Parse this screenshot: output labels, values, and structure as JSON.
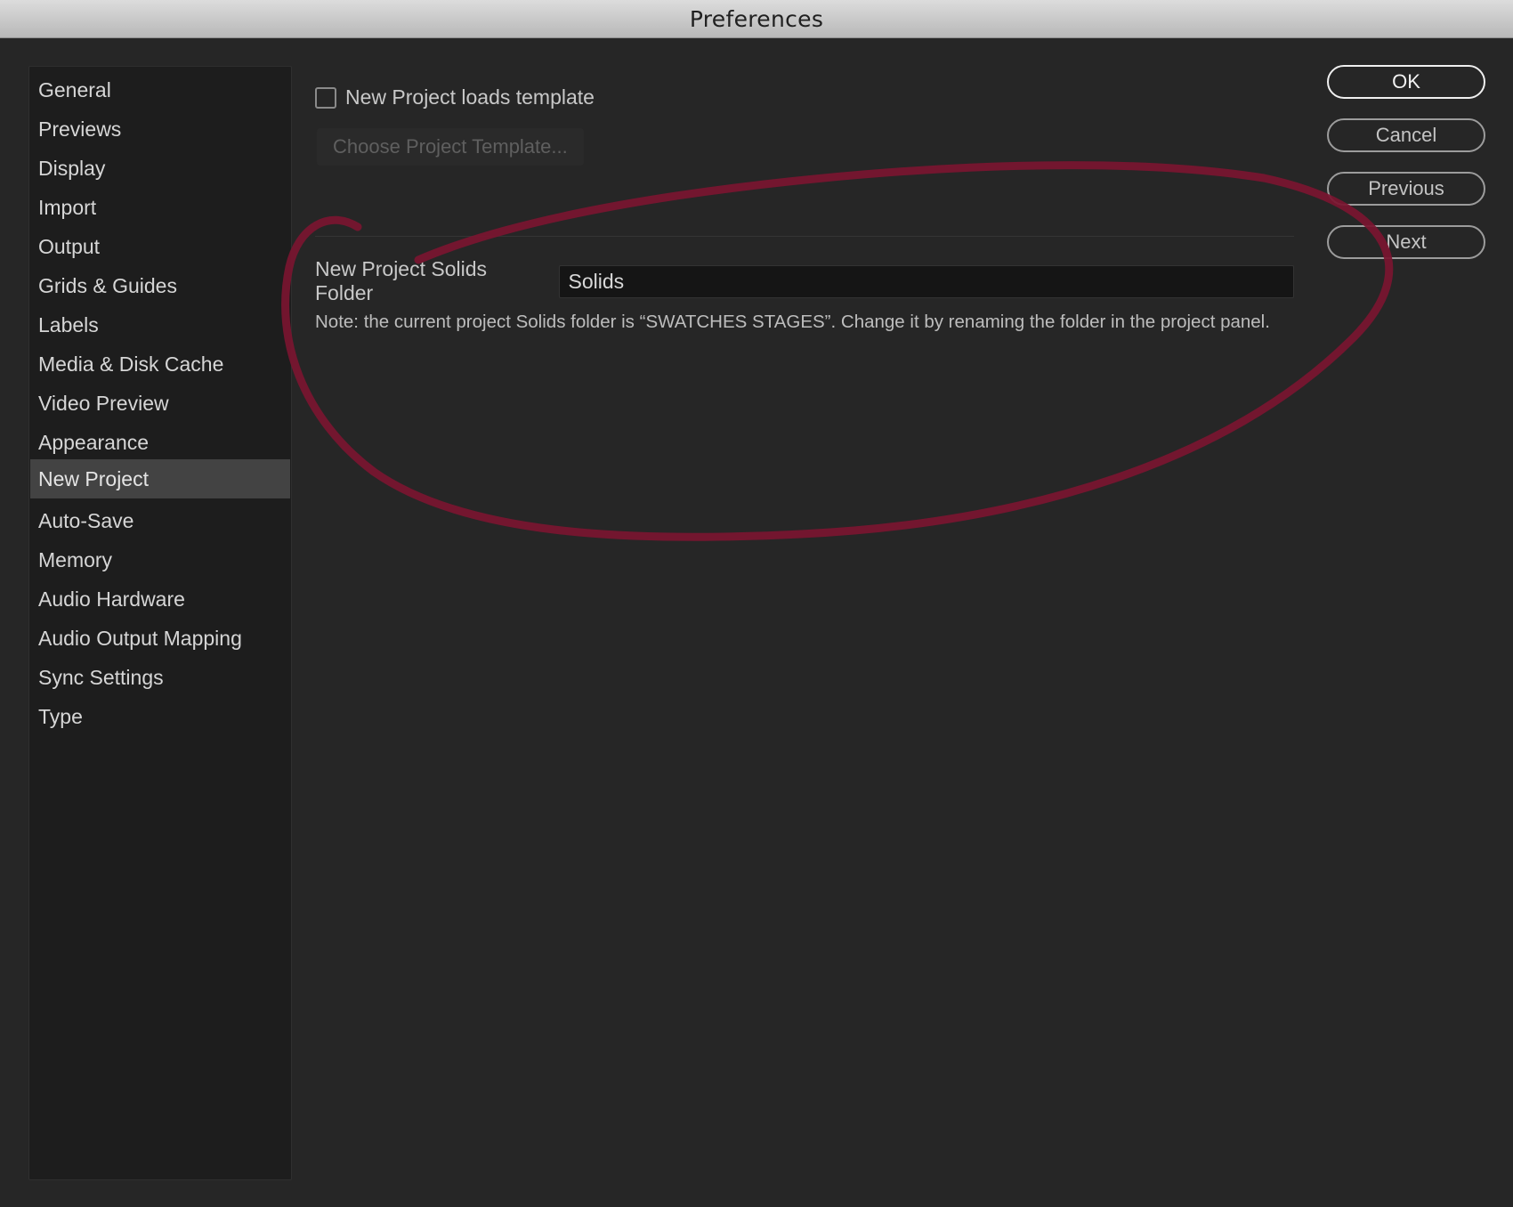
{
  "window": {
    "title": "Preferences"
  },
  "sidebar": {
    "selected_index": 10,
    "items": [
      {
        "label": "General"
      },
      {
        "label": "Previews"
      },
      {
        "label": "Display"
      },
      {
        "label": "Import"
      },
      {
        "label": "Output"
      },
      {
        "label": "Grids & Guides"
      },
      {
        "label": "Labels"
      },
      {
        "label": "Media & Disk Cache"
      },
      {
        "label": "Video Preview"
      },
      {
        "label": "Appearance"
      },
      {
        "label": "New Project"
      },
      {
        "label": "Auto-Save"
      },
      {
        "label": "Memory"
      },
      {
        "label": "Audio Hardware"
      },
      {
        "label": "Audio Output Mapping"
      },
      {
        "label": "Sync Settings"
      },
      {
        "label": "Type"
      }
    ]
  },
  "new_project": {
    "loads_template_label": "New Project loads template",
    "loads_template_checked": false,
    "choose_template_label": "Choose Project Template...",
    "choose_template_enabled": false,
    "solids_folder_label": "New Project Solids Folder",
    "solids_folder_value": "Solids",
    "note": "Note: the current project Solids folder is “SWATCHES STAGES”. Change it by renaming the folder in the project panel."
  },
  "buttons": {
    "ok": "OK",
    "cancel": "Cancel",
    "previous": "Previous",
    "next": "Next"
  },
  "colors": {
    "annotation": "#7a1530",
    "background": "#262626",
    "sidebar": "#1d1d1d",
    "selected": "#434343"
  }
}
